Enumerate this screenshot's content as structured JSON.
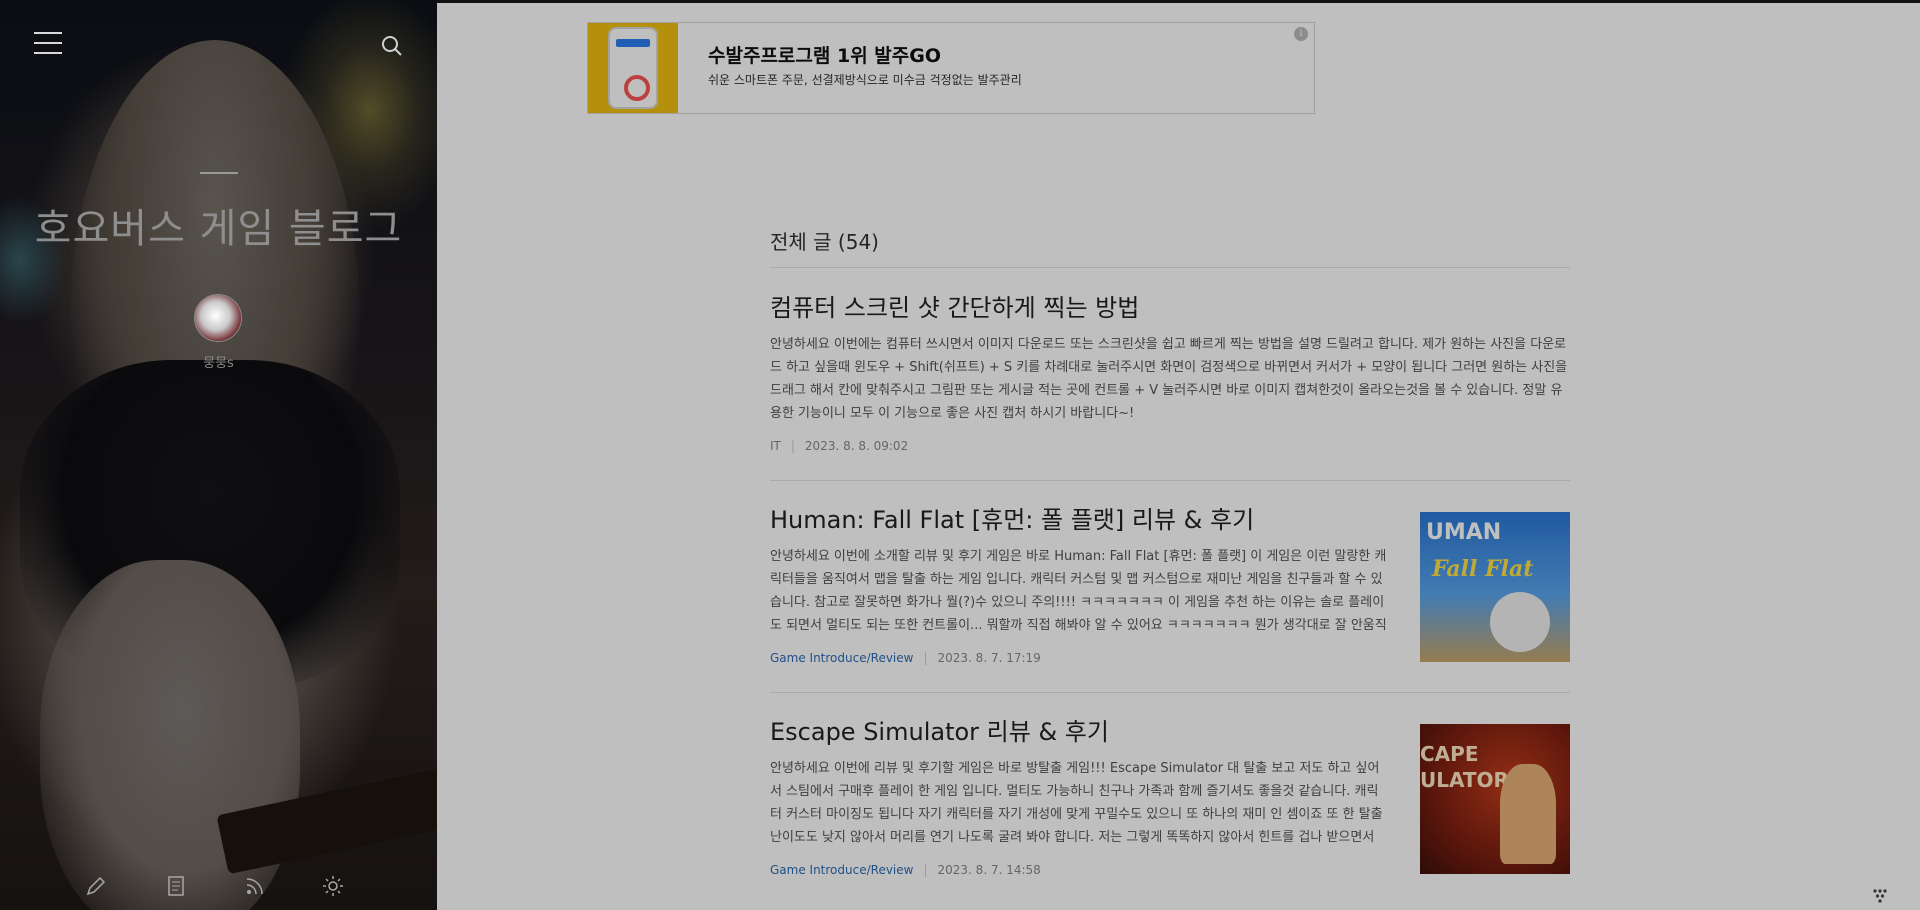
{
  "sidebar": {
    "blog_title": "호요버스 게임 블로그",
    "author": "뭉뭉s",
    "tools": [
      "pencil-icon",
      "notebook-icon",
      "rss-icon",
      "gear-icon"
    ]
  },
  "ad": {
    "title": "수발주프로그램 1위 발주GO",
    "subtitle": "쉬운 스마트폰 주문, 선결제방식으로 미수금 걱정없는 발주관리",
    "info": "i"
  },
  "section": {
    "heading": "전체 글 (54)"
  },
  "posts": [
    {
      "title": "컴퓨터 스크린 샷 간단하게 찍는 방법",
      "excerpt": "안녕하세요 이번에는 컴퓨터 쓰시면서 이미지 다운로드 또는 스크린샷을 쉽고 빠르게 찍는 방법을 설명 드릴려고 합니다. 제가 원하는 사진을 다운로드 하고 싶을때 윈도우 + Shift(쉬프트) + S 키를 차례대로 눌러주시면 화면이 검정색으로 바뀌면서 커서가 + 모양이 됩니다 그러면 원하는 사진을 드래그 해서 칸에 맞춰주시고 그림판 또는 게시글 적는 곳에 컨트롤 + V 눌러주시면 바로 이미지 캡쳐한것이 올라오는것을 볼 수 있습니다. 정말 유용한 기능이니 모두 이 기능으로 좋은 사진 캡처 하시기 바랍니다~!",
      "category": "IT",
      "date": "2023. 8. 8. 09:02"
    },
    {
      "title": "Human: Fall Flat [휴먼: 폴 플랫] 리뷰 & 후기",
      "excerpt": "안녕하세요 이번에 소개할 리뷰 및 후기 게임은 바로 Human: Fall Flat [휴먼: 폴 플랫] 이 게임은 이런 말랑한 캐릭터들을 움직여서 맵을 탈출 하는 게임 입니다. 캐릭터 커스텀 및 맵 커스텀으로 재미난 게임을 친구들과 할 수 있습니다. 참고로 잘못하면 화가나 뭘(?)수 있으니 주의!!!! ㅋㅋㅋㅋㅋㅋㅋ 이 게임을 추천 하는 이유는 솔로 플레이도 되면서 멀티도 되는 또한 컨트롤이... 뭐할까 직접 해봐야 알 수 있어요 ㅋㅋㅋㅋㅋㅋㅋ 뭔가 생각대로 잘 안움직여서 죽기도 하…",
      "category": "Game Introduce/Review",
      "date": "2023. 8. 7. 17:19",
      "thumb_text": [
        "UMAN",
        "Fall Flat"
      ]
    },
    {
      "title": "Escape Simulator 리뷰 & 후기",
      "excerpt": "안녕하세요 이번에 리뷰 및 후기할 게임은 바로 방탈출 게임!!! Escape Simulator 대 탈출 보고 저도 하고 싶어서 스팀에서 구매후 플레이 한 게임 입니다. 멀티도 가능하니 친구나 가족과 함께 즐기셔도 좋을것 같습니다. 캐릭터 커스터 마이징도 됩니다 자기 캐릭터를 자기 개성에 맞게 꾸밀수도 있으니 또 하나의 재미 인 셈이죠 또 한 탈출 난이도도 낮지 않아서 머리를 연기 나도록 굴려 봐야 합니다. 저는 그렇게 똑똑하지 않아서 힌트를 겁나 받으면서 해도 시간이 오래 걸…",
      "category": "Game Introduce/Review",
      "date": "2023. 8. 7. 14:58",
      "thumb_text": [
        "CAPE",
        "ULATOR"
      ]
    }
  ]
}
